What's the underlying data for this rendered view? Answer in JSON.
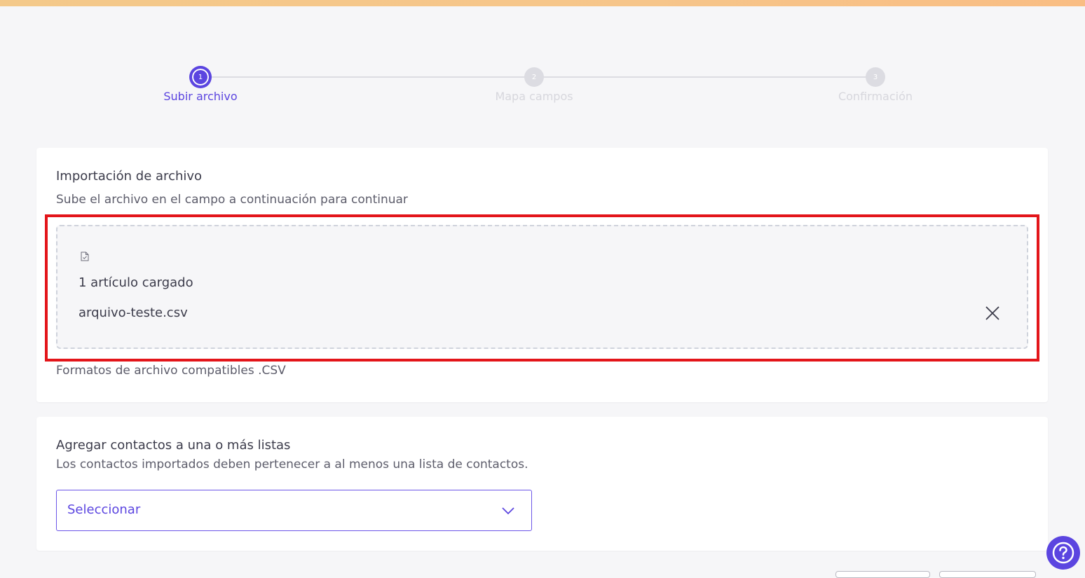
{
  "colors": {
    "accent": "#5b45e0",
    "highlight": "#e3151a",
    "inactive_step": "#dcdce2"
  },
  "stepper": {
    "steps": [
      {
        "number": "1",
        "label": "Subir archivo",
        "state": "active"
      },
      {
        "number": "2",
        "label": "Mapa campos",
        "state": "inactive"
      },
      {
        "number": "3",
        "label": "Confirmación",
        "state": "inactive"
      }
    ]
  },
  "import_card": {
    "title": "Importación de archivo",
    "subtitle": "Sube el archivo en el campo a continuación para continuar",
    "dropzone": {
      "file_icon": "file-check-icon",
      "uploaded_count": "1 artículo cargado",
      "file_name": "arquivo-teste.csv",
      "remove_icon": "close-icon"
    },
    "formats_text": "Formatos de archivo compatibles .CSV"
  },
  "lists_card": {
    "title": "Agregar contactos a una o más listas",
    "subtitle": "Los contactos importados deben pertenecer a al menos una lista de contactos.",
    "select": {
      "value": "Seleccionar",
      "icon": "chevron-down-icon"
    }
  },
  "help_button": {
    "icon": "question-circle-icon"
  }
}
